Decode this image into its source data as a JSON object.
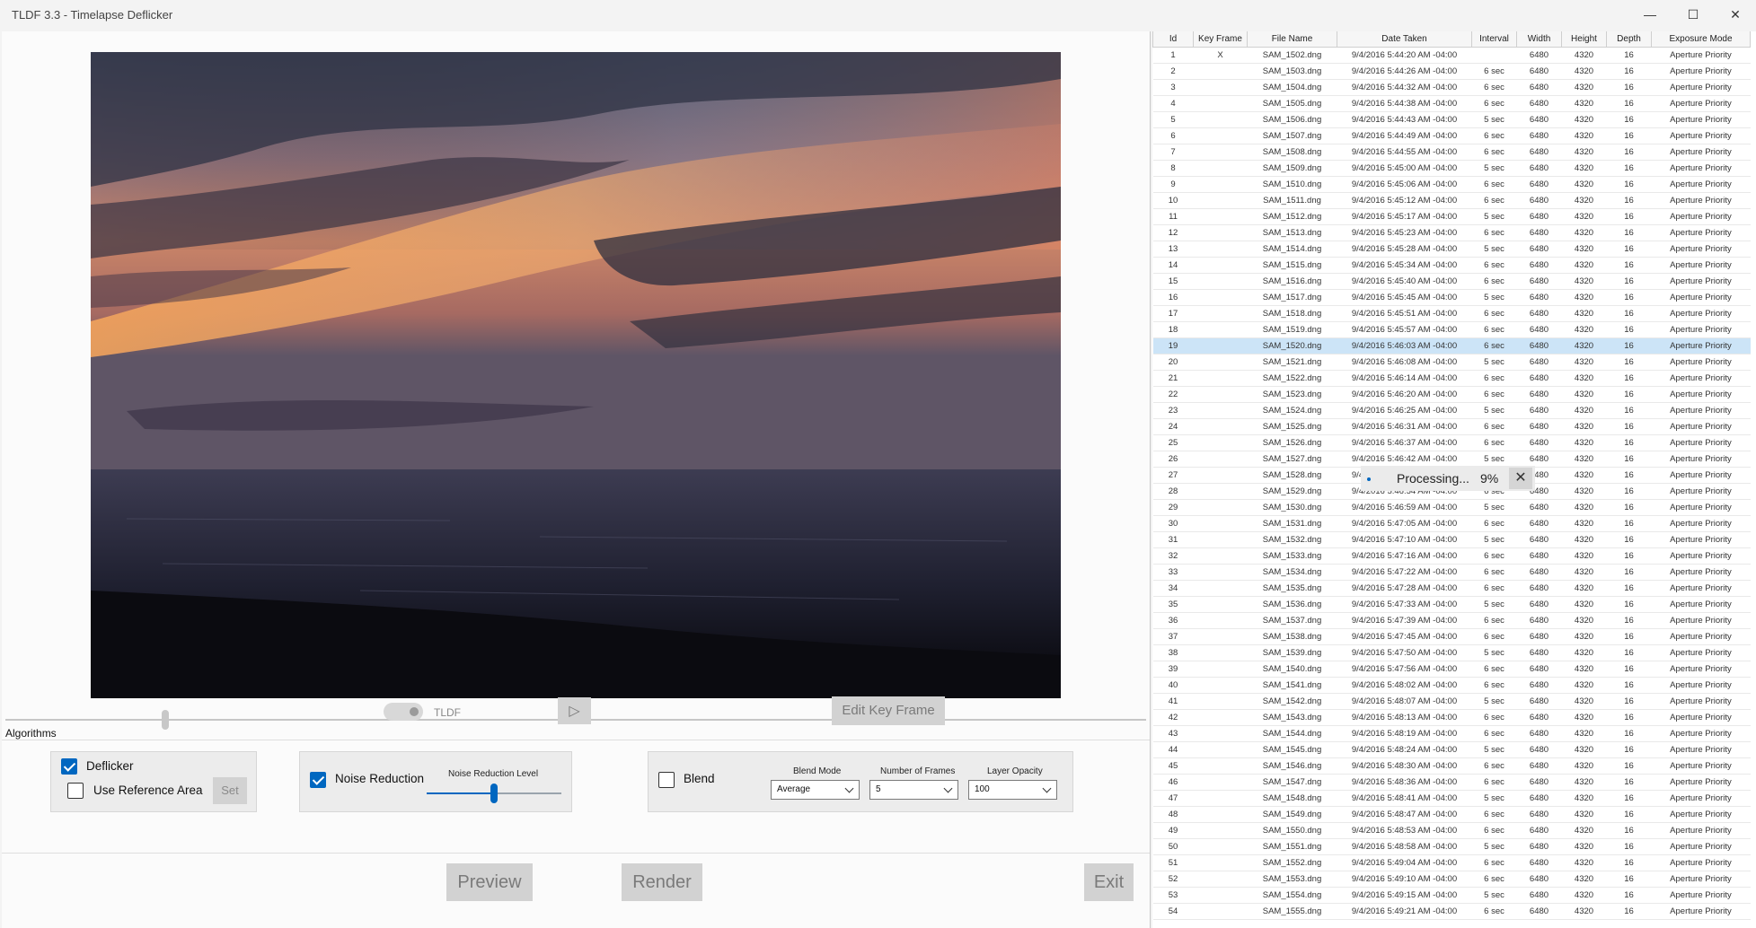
{
  "window": {
    "title": "TLDF 3.3 - Timelapse Deflicker",
    "minimize_glyph": "—",
    "maximize_glyph": "☐",
    "close_glyph": "✕"
  },
  "viewer": {
    "toggle_label": "TLDF",
    "play_glyph": "▷",
    "edit_key_frame": "Edit Key Frame",
    "timeline_position": 0.14
  },
  "algorithms": {
    "section_label": "Algorithms",
    "deflicker": {
      "label": "Deflicker",
      "checked": true
    },
    "use_reference_area": {
      "label": "Use Reference Area",
      "checked": false
    },
    "set_button": "Set",
    "noise_reduction": {
      "label": "Noise Reduction",
      "checked": true
    },
    "noise_reduction_level": {
      "label": "Noise Reduction Level",
      "value": 0.5
    },
    "blend": {
      "label": "Blend",
      "checked": false
    },
    "blend_mode": {
      "label": "Blend Mode",
      "value": "Average"
    },
    "number_of_frames": {
      "label": "Number of Frames",
      "value": "5"
    },
    "layer_opacity": {
      "label": "Layer Opacity",
      "value": "100"
    }
  },
  "actions": {
    "preview": "Preview",
    "render": "Render",
    "exit": "Exit"
  },
  "processing": {
    "label": "Processing...",
    "percent": "9%",
    "close_glyph": "✕"
  },
  "grid": {
    "columns": [
      "Id",
      "Key Frame",
      "File Name",
      "Date Taken",
      "Interval",
      "Width",
      "Height",
      "Depth",
      "Exposure Mode"
    ],
    "selected_id": "19",
    "rows": [
      [
        "1",
        "X",
        "SAM_1502.dng",
        "9/4/2016 5:44:20 AM -04:00",
        "",
        "6480",
        "4320",
        "16",
        "Aperture Priority"
      ],
      [
        "2",
        "",
        "SAM_1503.dng",
        "9/4/2016 5:44:26 AM -04:00",
        "6 sec",
        "6480",
        "4320",
        "16",
        "Aperture Priority"
      ],
      [
        "3",
        "",
        "SAM_1504.dng",
        "9/4/2016 5:44:32 AM -04:00",
        "6 sec",
        "6480",
        "4320",
        "16",
        "Aperture Priority"
      ],
      [
        "4",
        "",
        "SAM_1505.dng",
        "9/4/2016 5:44:38 AM -04:00",
        "6 sec",
        "6480",
        "4320",
        "16",
        "Aperture Priority"
      ],
      [
        "5",
        "",
        "SAM_1506.dng",
        "9/4/2016 5:44:43 AM -04:00",
        "5 sec",
        "6480",
        "4320",
        "16",
        "Aperture Priority"
      ],
      [
        "6",
        "",
        "SAM_1507.dng",
        "9/4/2016 5:44:49 AM -04:00",
        "6 sec",
        "6480",
        "4320",
        "16",
        "Aperture Priority"
      ],
      [
        "7",
        "",
        "SAM_1508.dng",
        "9/4/2016 5:44:55 AM -04:00",
        "6 sec",
        "6480",
        "4320",
        "16",
        "Aperture Priority"
      ],
      [
        "8",
        "",
        "SAM_1509.dng",
        "9/4/2016 5:45:00 AM -04:00",
        "5 sec",
        "6480",
        "4320",
        "16",
        "Aperture Priority"
      ],
      [
        "9",
        "",
        "SAM_1510.dng",
        "9/4/2016 5:45:06 AM -04:00",
        "6 sec",
        "6480",
        "4320",
        "16",
        "Aperture Priority"
      ],
      [
        "10",
        "",
        "SAM_1511.dng",
        "9/4/2016 5:45:12 AM -04:00",
        "6 sec",
        "6480",
        "4320",
        "16",
        "Aperture Priority"
      ],
      [
        "11",
        "",
        "SAM_1512.dng",
        "9/4/2016 5:45:17 AM -04:00",
        "5 sec",
        "6480",
        "4320",
        "16",
        "Aperture Priority"
      ],
      [
        "12",
        "",
        "SAM_1513.dng",
        "9/4/2016 5:45:23 AM -04:00",
        "6 sec",
        "6480",
        "4320",
        "16",
        "Aperture Priority"
      ],
      [
        "13",
        "",
        "SAM_1514.dng",
        "9/4/2016 5:45:28 AM -04:00",
        "5 sec",
        "6480",
        "4320",
        "16",
        "Aperture Priority"
      ],
      [
        "14",
        "",
        "SAM_1515.dng",
        "9/4/2016 5:45:34 AM -04:00",
        "6 sec",
        "6480",
        "4320",
        "16",
        "Aperture Priority"
      ],
      [
        "15",
        "",
        "SAM_1516.dng",
        "9/4/2016 5:45:40 AM -04:00",
        "6 sec",
        "6480",
        "4320",
        "16",
        "Aperture Priority"
      ],
      [
        "16",
        "",
        "SAM_1517.dng",
        "9/4/2016 5:45:45 AM -04:00",
        "5 sec",
        "6480",
        "4320",
        "16",
        "Aperture Priority"
      ],
      [
        "17",
        "",
        "SAM_1518.dng",
        "9/4/2016 5:45:51 AM -04:00",
        "6 sec",
        "6480",
        "4320",
        "16",
        "Aperture Priority"
      ],
      [
        "18",
        "",
        "SAM_1519.dng",
        "9/4/2016 5:45:57 AM -04:00",
        "6 sec",
        "6480",
        "4320",
        "16",
        "Aperture Priority"
      ],
      [
        "19",
        "",
        "SAM_1520.dng",
        "9/4/2016 5:46:03 AM -04:00",
        "6 sec",
        "6480",
        "4320",
        "16",
        "Aperture Priority"
      ],
      [
        "20",
        "",
        "SAM_1521.dng",
        "9/4/2016 5:46:08 AM -04:00",
        "5 sec",
        "6480",
        "4320",
        "16",
        "Aperture Priority"
      ],
      [
        "21",
        "",
        "SAM_1522.dng",
        "9/4/2016 5:46:14 AM -04:00",
        "6 sec",
        "6480",
        "4320",
        "16",
        "Aperture Priority"
      ],
      [
        "22",
        "",
        "SAM_1523.dng",
        "9/4/2016 5:46:20 AM -04:00",
        "6 sec",
        "6480",
        "4320",
        "16",
        "Aperture Priority"
      ],
      [
        "23",
        "",
        "SAM_1524.dng",
        "9/4/2016 5:46:25 AM -04:00",
        "5 sec",
        "6480",
        "4320",
        "16",
        "Aperture Priority"
      ],
      [
        "24",
        "",
        "SAM_1525.dng",
        "9/4/2016 5:46:31 AM -04:00",
        "6 sec",
        "6480",
        "4320",
        "16",
        "Aperture Priority"
      ],
      [
        "25",
        "",
        "SAM_1526.dng",
        "9/4/2016 5:46:37 AM -04:00",
        "6 sec",
        "6480",
        "4320",
        "16",
        "Aperture Priority"
      ],
      [
        "26",
        "",
        "SAM_1527.dng",
        "9/4/2016 5:46:42 AM -04:00",
        "5 sec",
        "6480",
        "4320",
        "16",
        "Aperture Priority"
      ],
      [
        "27",
        "",
        "SAM_1528.dng",
        "9/4/2016 5:46:48 AM -04:00",
        "6 sec",
        "6480",
        "4320",
        "16",
        "Aperture Priority"
      ],
      [
        "28",
        "",
        "SAM_1529.dng",
        "9/4/2016 5:46:54 AM -04:00",
        "6 sec",
        "6480",
        "4320",
        "16",
        "Aperture Priority"
      ],
      [
        "29",
        "",
        "SAM_1530.dng",
        "9/4/2016 5:46:59 AM -04:00",
        "5 sec",
        "6480",
        "4320",
        "16",
        "Aperture Priority"
      ],
      [
        "30",
        "",
        "SAM_1531.dng",
        "9/4/2016 5:47:05 AM -04:00",
        "6 sec",
        "6480",
        "4320",
        "16",
        "Aperture Priority"
      ],
      [
        "31",
        "",
        "SAM_1532.dng",
        "9/4/2016 5:47:10 AM -04:00",
        "5 sec",
        "6480",
        "4320",
        "16",
        "Aperture Priority"
      ],
      [
        "32",
        "",
        "SAM_1533.dng",
        "9/4/2016 5:47:16 AM -04:00",
        "6 sec",
        "6480",
        "4320",
        "16",
        "Aperture Priority"
      ],
      [
        "33",
        "",
        "SAM_1534.dng",
        "9/4/2016 5:47:22 AM -04:00",
        "6 sec",
        "6480",
        "4320",
        "16",
        "Aperture Priority"
      ],
      [
        "34",
        "",
        "SAM_1535.dng",
        "9/4/2016 5:47:28 AM -04:00",
        "6 sec",
        "6480",
        "4320",
        "16",
        "Aperture Priority"
      ],
      [
        "35",
        "",
        "SAM_1536.dng",
        "9/4/2016 5:47:33 AM -04:00",
        "5 sec",
        "6480",
        "4320",
        "16",
        "Aperture Priority"
      ],
      [
        "36",
        "",
        "SAM_1537.dng",
        "9/4/2016 5:47:39 AM -04:00",
        "6 sec",
        "6480",
        "4320",
        "16",
        "Aperture Priority"
      ],
      [
        "37",
        "",
        "SAM_1538.dng",
        "9/4/2016 5:47:45 AM -04:00",
        "6 sec",
        "6480",
        "4320",
        "16",
        "Aperture Priority"
      ],
      [
        "38",
        "",
        "SAM_1539.dng",
        "9/4/2016 5:47:50 AM -04:00",
        "5 sec",
        "6480",
        "4320",
        "16",
        "Aperture Priority"
      ],
      [
        "39",
        "",
        "SAM_1540.dng",
        "9/4/2016 5:47:56 AM -04:00",
        "6 sec",
        "6480",
        "4320",
        "16",
        "Aperture Priority"
      ],
      [
        "40",
        "",
        "SAM_1541.dng",
        "9/4/2016 5:48:02 AM -04:00",
        "6 sec",
        "6480",
        "4320",
        "16",
        "Aperture Priority"
      ],
      [
        "41",
        "",
        "SAM_1542.dng",
        "9/4/2016 5:48:07 AM -04:00",
        "5 sec",
        "6480",
        "4320",
        "16",
        "Aperture Priority"
      ],
      [
        "42",
        "",
        "SAM_1543.dng",
        "9/4/2016 5:48:13 AM -04:00",
        "6 sec",
        "6480",
        "4320",
        "16",
        "Aperture Priority"
      ],
      [
        "43",
        "",
        "SAM_1544.dng",
        "9/4/2016 5:48:19 AM -04:00",
        "6 sec",
        "6480",
        "4320",
        "16",
        "Aperture Priority"
      ],
      [
        "44",
        "",
        "SAM_1545.dng",
        "9/4/2016 5:48:24 AM -04:00",
        "5 sec",
        "6480",
        "4320",
        "16",
        "Aperture Priority"
      ],
      [
        "45",
        "",
        "SAM_1546.dng",
        "9/4/2016 5:48:30 AM -04:00",
        "6 sec",
        "6480",
        "4320",
        "16",
        "Aperture Priority"
      ],
      [
        "46",
        "",
        "SAM_1547.dng",
        "9/4/2016 5:48:36 AM -04:00",
        "6 sec",
        "6480",
        "4320",
        "16",
        "Aperture Priority"
      ],
      [
        "47",
        "",
        "SAM_1548.dng",
        "9/4/2016 5:48:41 AM -04:00",
        "5 sec",
        "6480",
        "4320",
        "16",
        "Aperture Priority"
      ],
      [
        "48",
        "",
        "SAM_1549.dng",
        "9/4/2016 5:48:47 AM -04:00",
        "6 sec",
        "6480",
        "4320",
        "16",
        "Aperture Priority"
      ],
      [
        "49",
        "",
        "SAM_1550.dng",
        "9/4/2016 5:48:53 AM -04:00",
        "6 sec",
        "6480",
        "4320",
        "16",
        "Aperture Priority"
      ],
      [
        "50",
        "",
        "SAM_1551.dng",
        "9/4/2016 5:48:58 AM -04:00",
        "5 sec",
        "6480",
        "4320",
        "16",
        "Aperture Priority"
      ],
      [
        "51",
        "",
        "SAM_1552.dng",
        "9/4/2016 5:49:04 AM -04:00",
        "6 sec",
        "6480",
        "4320",
        "16",
        "Aperture Priority"
      ],
      [
        "52",
        "",
        "SAM_1553.dng",
        "9/4/2016 5:49:10 AM -04:00",
        "6 sec",
        "6480",
        "4320",
        "16",
        "Aperture Priority"
      ],
      [
        "53",
        "",
        "SAM_1554.dng",
        "9/4/2016 5:49:15 AM -04:00",
        "5 sec",
        "6480",
        "4320",
        "16",
        "Aperture Priority"
      ],
      [
        "54",
        "",
        "SAM_1555.dng",
        "9/4/2016 5:49:21 AM -04:00",
        "6 sec",
        "6480",
        "4320",
        "16",
        "Aperture Priority"
      ]
    ]
  },
  "colors": {
    "accent": "#0067c0",
    "selection": "#cce4f7",
    "disabled_button": "#d2d2d2"
  }
}
